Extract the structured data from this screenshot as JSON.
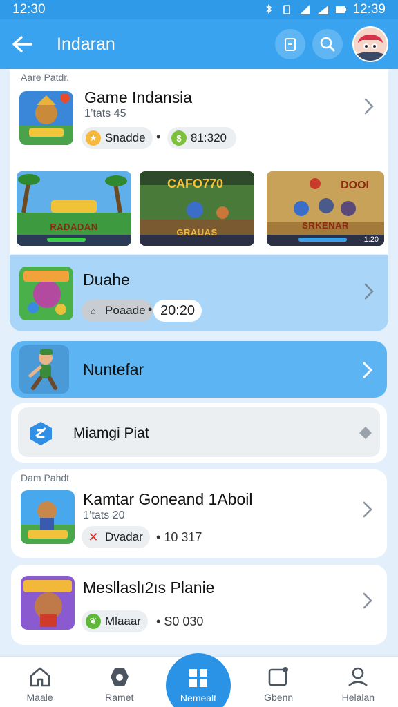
{
  "status": {
    "time_left": "12:30",
    "time_right": "12:39"
  },
  "appbar": {
    "title": "Indaran"
  },
  "featured": {
    "tag": "Aare Patdr.",
    "title": "Game Indansia",
    "subtitle": "1’tats 45",
    "pill_label": "Snadde",
    "value": "81:320",
    "screenshots": [
      {
        "label": "RADADAN"
      },
      {
        "label": "GRAUAS",
        "top_text": "CAFO770"
      },
      {
        "label": "SRKENAR",
        "top_text": "DOOI",
        "corner": "1:20"
      }
    ]
  },
  "item2": {
    "title": "Duahe",
    "pill_label": "Poaade",
    "value": "20:20"
  },
  "item3": {
    "title": "Nuntefar"
  },
  "item4": {
    "title": "Miamgi Piat"
  },
  "section2": {
    "tag": "Dam Pahdt"
  },
  "item5": {
    "title": "Kamtar Goneand 1Aboil",
    "subtitle": "1’tats 20",
    "pill_label": "Dvadar",
    "value": "10 317"
  },
  "item6": {
    "title": "Mesllaslı2ıs Planie",
    "pill_label": "Mlaaar",
    "value": "S0 030"
  },
  "nav": {
    "items": [
      {
        "label": "Maale"
      },
      {
        "label": "Ramet"
      },
      {
        "label": "Nemealt"
      },
      {
        "label": "Gbenn"
      },
      {
        "label": "Helalan"
      }
    ]
  },
  "colors": {
    "accent": "#39a3ef",
    "selected": "#5cb5f2",
    "light_blue": "#a9d6f8"
  }
}
